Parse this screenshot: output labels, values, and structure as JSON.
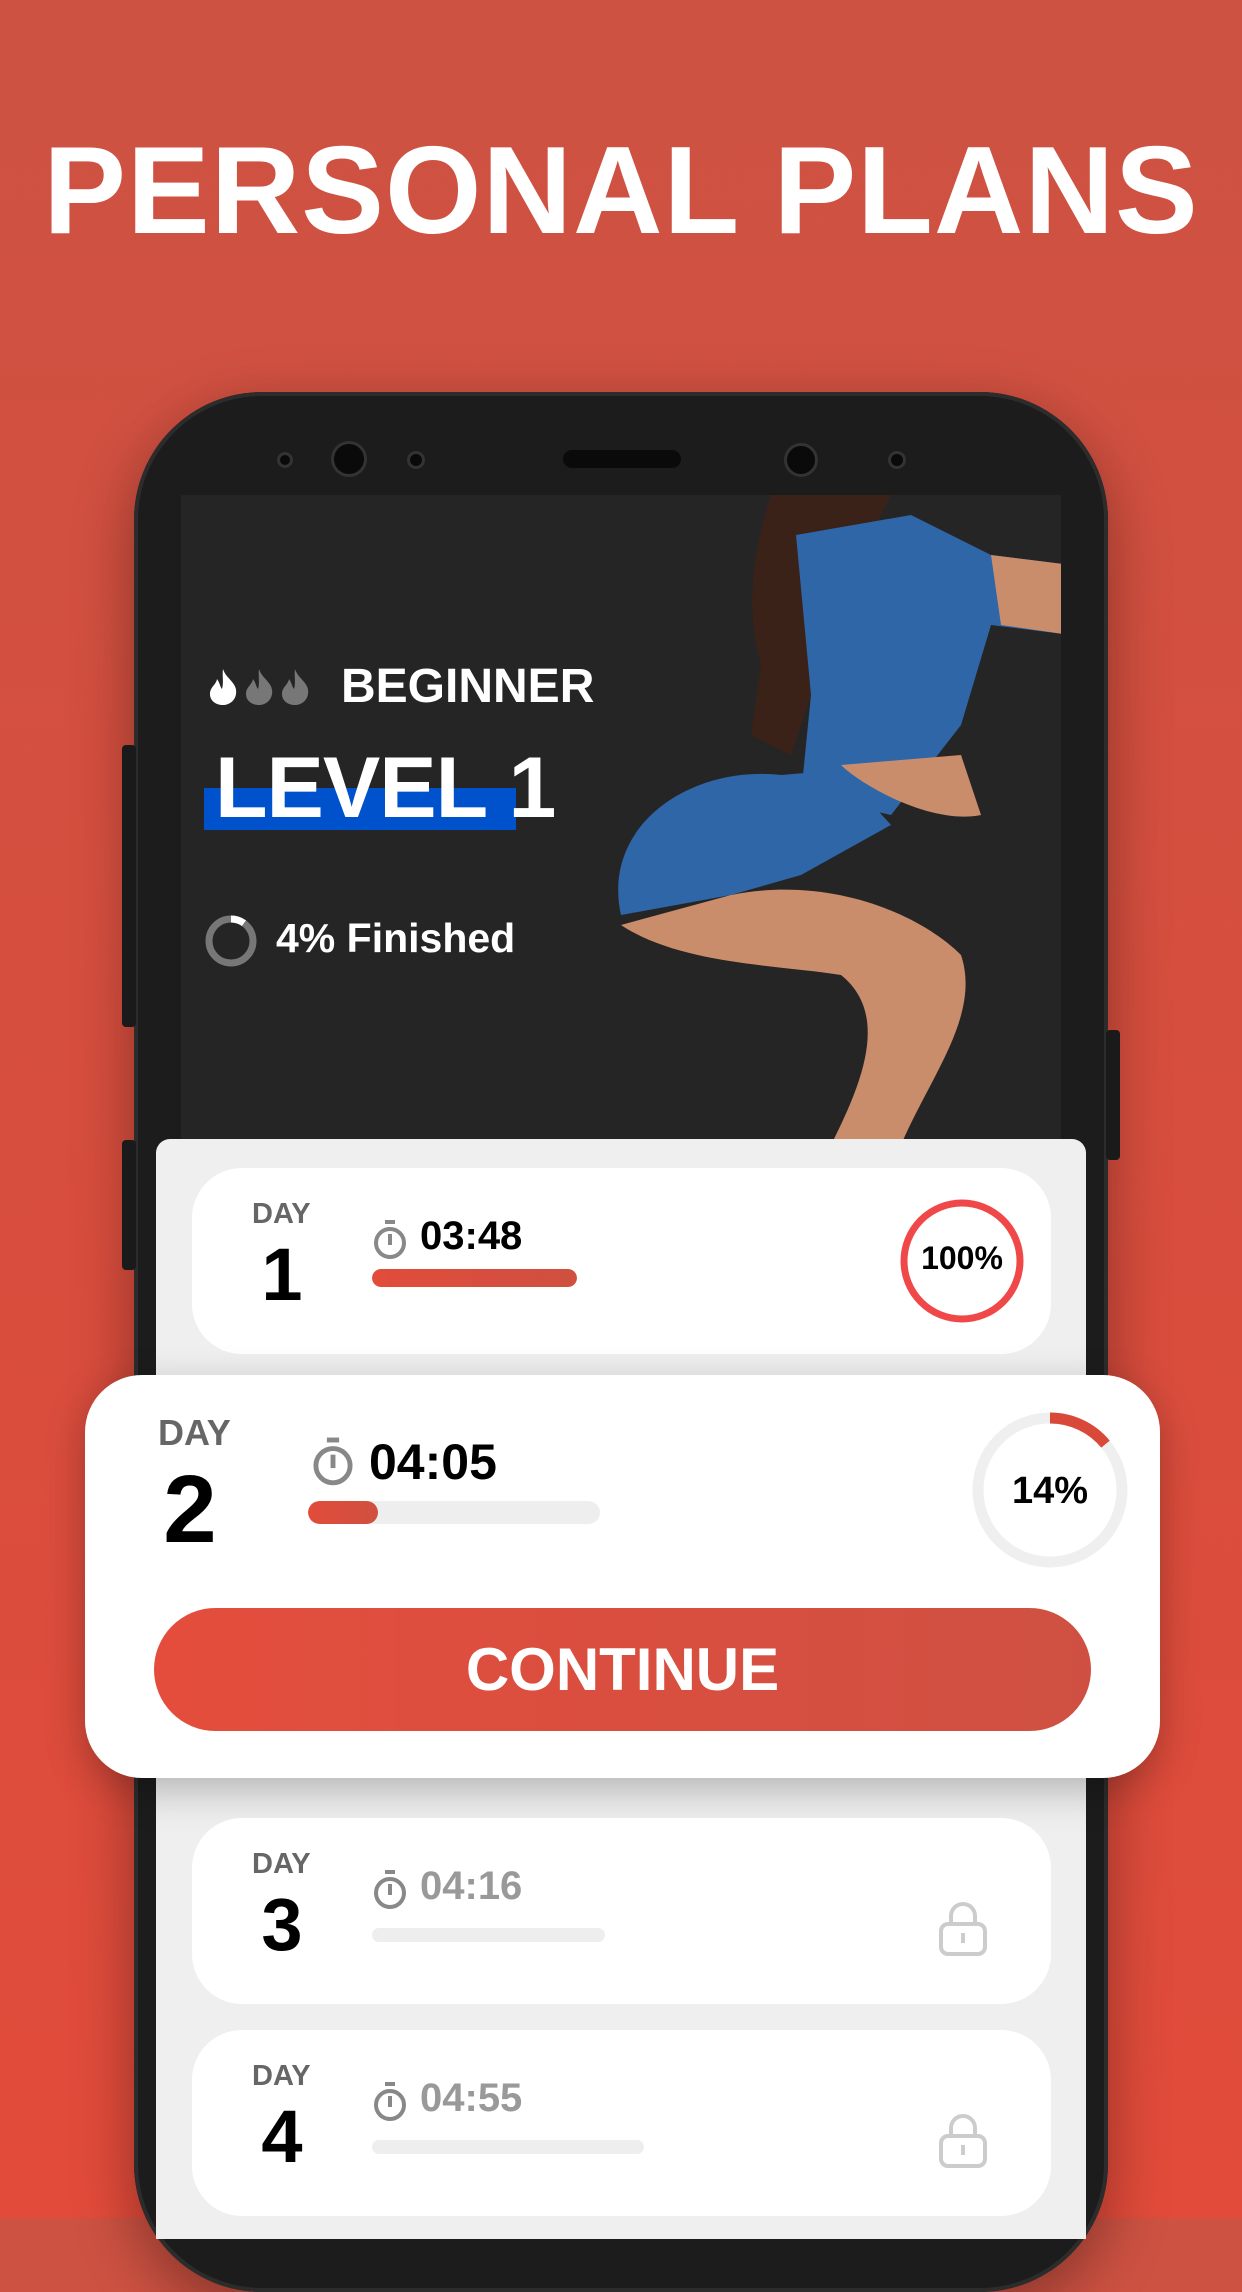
{
  "headline": "PERSONAL PLANS",
  "plan": {
    "difficulty": "BEGINNER",
    "difficulty_flames_active": 1,
    "difficulty_flames_total": 3,
    "level": "LEVEL 1",
    "progress_percent": 4,
    "progress_text": "4% Finished"
  },
  "days": [
    {
      "label": "DAY",
      "number": "1",
      "duration": "03:48",
      "percent_text": "100%",
      "percent": 100,
      "locked": false
    },
    {
      "label": "DAY",
      "number": "2",
      "duration": "04:05",
      "percent_text": "14%",
      "percent": 14,
      "locked": false
    },
    {
      "label": "DAY",
      "number": "3",
      "duration": "04:16",
      "locked": true
    },
    {
      "label": "DAY",
      "number": "4",
      "duration": "04:55",
      "locked": true
    }
  ],
  "continue_label": "CONTINUE",
  "colors": {
    "accent": "#e24c3b",
    "level_highlight": "#0052cc",
    "background": "#d44e3e"
  }
}
